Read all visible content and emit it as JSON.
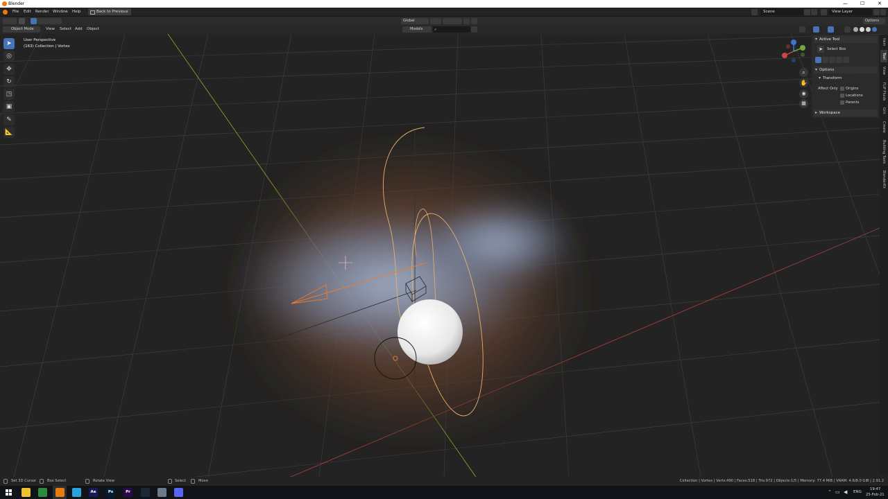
{
  "window": {
    "title": "Blender",
    "controls": [
      "—",
      "☐",
      "✕"
    ]
  },
  "topbar": {
    "menus": [
      "File",
      "Edit",
      "Render",
      "Window",
      "Help"
    ],
    "back_button": "Back to Previous",
    "scene": "Scene",
    "view_layer": "View Layer"
  },
  "header2": {
    "orientation": "Global",
    "options": "Options"
  },
  "header3": {
    "mode": "Object Mode",
    "menus": [
      "View",
      "Select",
      "Add",
      "Object"
    ],
    "models_select": "Models"
  },
  "viewport": {
    "perspective_label": "User Perspective",
    "collection_label": "(163) Collection | Vortex"
  },
  "npanel": {
    "active_tool_title": "Active Tool",
    "tool_name": "Select Box",
    "options_title": "Options",
    "transform_title": "Transform",
    "affect_only": "Affect Only",
    "checks": [
      "Origins",
      "Locations",
      "Parents"
    ],
    "workspace_title": "Workspace"
  },
  "sidetabs": [
    "Item",
    "Tool",
    "View",
    "FLIP Fluids",
    "Grit",
    "Create",
    "Building Tools",
    "BlenderKit"
  ],
  "statusbar": {
    "hints": [
      "Set 3D Cursor",
      "Box Select",
      "Rotate View",
      "Select",
      "Move"
    ],
    "stats": "Collection | Vortex | Verts:490 | Faces:518 | Tris:972 | Objects:1/5 | Memory: 77.4 MiB | VRAM: 4.6/8.0 GiB | 2.91.2"
  },
  "taskbar": {
    "apps": [
      {
        "name": "file-explorer-icon",
        "label": "",
        "color": "#f0c030"
      },
      {
        "name": "chrome-icon",
        "label": "",
        "color": "#2e8b3d"
      },
      {
        "name": "blender-icon",
        "label": "",
        "color": "#e87d0d"
      },
      {
        "name": "telegram-icon",
        "label": "",
        "color": "#2aa3dd"
      },
      {
        "name": "after-effects-icon",
        "label": "Ae",
        "color": "#1a1a5a"
      },
      {
        "name": "photoshop-icon",
        "label": "Ps",
        "color": "#001e36"
      },
      {
        "name": "premiere-icon",
        "label": "Pr",
        "color": "#2a0a4a"
      },
      {
        "name": "steam-icon",
        "label": "",
        "color": "#1b2838"
      },
      {
        "name": "monitor-app-icon",
        "label": "",
        "color": "#6a7a8a"
      },
      {
        "name": "discord-icon",
        "label": "",
        "color": "#5865f2"
      }
    ],
    "lang": "ENG",
    "time": "19:47",
    "date": "25-Feb-21"
  }
}
